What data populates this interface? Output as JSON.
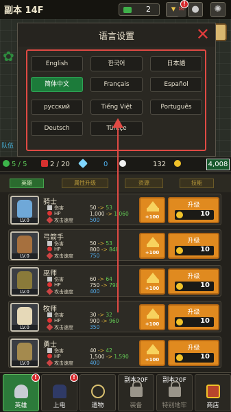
{
  "header": {
    "floor_label": "副本 14F",
    "ticket_count": "2"
  },
  "modal": {
    "title": "语言设置",
    "languages": [
      {
        "label": "English",
        "selected": false
      },
      {
        "label": "한국어",
        "selected": false
      },
      {
        "label": "日本語",
        "selected": false
      },
      {
        "label": "简体中文",
        "selected": true
      },
      {
        "label": "Français",
        "selected": false
      },
      {
        "label": "Español",
        "selected": false
      },
      {
        "label": "русский",
        "selected": false
      },
      {
        "label": "Tiếng Việt",
        "selected": false
      },
      {
        "label": "Português",
        "selected": false
      },
      {
        "label": "Deutsch",
        "selected": false
      },
      {
        "label": "Türkçe",
        "selected": false
      }
    ]
  },
  "side_label": "队伍",
  "resources": {
    "party": "5 / 5",
    "potion": "2 / 20",
    "gems": "0",
    "skulls": "132",
    "gold": "4,008"
  },
  "tabs": [
    "英雄",
    "属性升级",
    "资源",
    "技能"
  ],
  "heroes": [
    {
      "name": "骑士",
      "level": "LV.0",
      "atk_label": "伤害",
      "hp_label": "HP",
      "spd_label": "攻击速度",
      "atk_old": "50",
      "atk_new": "53",
      "hp_old": "1,000",
      "hp_new": "1,060",
      "spd": "500",
      "upgrade_label": "升级",
      "cost": "10",
      "bulk_label": "+100",
      "color": "#6fa8d8"
    },
    {
      "name": "弓箭手",
      "level": "LV.0",
      "atk_label": "伤害",
      "hp_label": "HP",
      "spd_label": "攻击速度",
      "atk_old": "50",
      "atk_new": "53",
      "hp_old": "800",
      "hp_new": "848",
      "spd": "750",
      "upgrade_label": "升级",
      "cost": "10",
      "bulk_label": "+100",
      "color": "#a6703e"
    },
    {
      "name": "巫师",
      "level": "LV.0",
      "atk_label": "伤害",
      "hp_label": "HP",
      "spd_label": "攻击速度",
      "atk_old": "60",
      "atk_new": "64",
      "hp_old": "750",
      "hp_new": "790",
      "spd": "400",
      "upgrade_label": "升级",
      "cost": "10",
      "bulk_label": "+100",
      "color": "#8a7a3a"
    },
    {
      "name": "牧师",
      "level": "LV.0",
      "atk_label": "伤害",
      "hp_label": "HP",
      "spd_label": "攻击速度",
      "atk_old": "30",
      "atk_new": "32",
      "hp_old": "900",
      "hp_new": "960",
      "spd": "350",
      "upgrade_label": "升级",
      "cost": "10",
      "bulk_label": "+100",
      "color": "#e6d9b8"
    },
    {
      "name": "勇士",
      "level": "LV.0",
      "atk_label": "伤害",
      "hp_label": "HP",
      "spd_label": "攻击速度",
      "atk_old": "40",
      "atk_new": "42",
      "hp_old": "1,500",
      "hp_new": "1,590",
      "spd": "400",
      "upgrade_label": "升级",
      "cost": "10",
      "bulk_label": "+100",
      "color": "#a48a4e"
    }
  ],
  "bottom_nav": [
    {
      "label": "英雄",
      "top": "",
      "active": true,
      "locked": false,
      "icon": "helmet-icon",
      "badge": true
    },
    {
      "label": "上电",
      "top": "",
      "active": false,
      "locked": false,
      "icon": "tower-icon",
      "badge": true
    },
    {
      "label": "遗物",
      "top": "",
      "active": false,
      "locked": false,
      "icon": "relic-icon",
      "badge": false
    },
    {
      "label": "装备",
      "top": "副本20F",
      "active": false,
      "locked": true,
      "icon": "lock-icon",
      "badge": false
    },
    {
      "label": "特别地牢",
      "top": "副本20F",
      "active": false,
      "locked": true,
      "icon": "lock-icon",
      "badge": false
    },
    {
      "label": "商店",
      "top": "",
      "active": false,
      "locked": false,
      "icon": "chest-icon",
      "badge": false
    }
  ]
}
